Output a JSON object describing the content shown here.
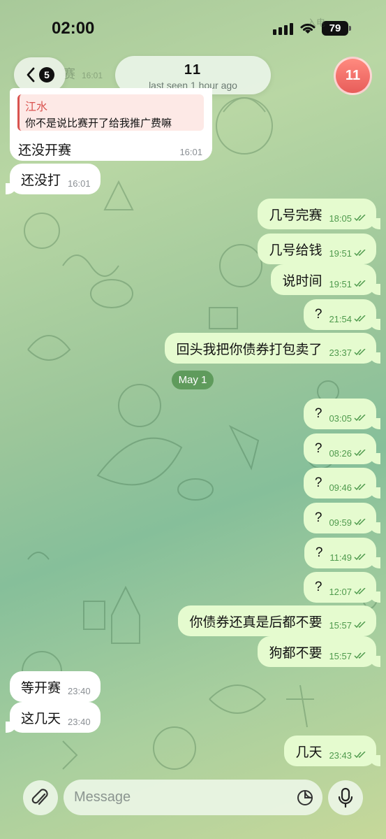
{
  "status": {
    "time": "02:00",
    "battery": "79"
  },
  "header": {
    "back_badge": "5",
    "chat_name": "11",
    "last_seen": "last seen 1 hour ago",
    "avatar_text": "11"
  },
  "ghost": {
    "behind_back": "赛",
    "behind_back_time": "16:01",
    "top_right": "入电"
  },
  "reply_message": {
    "quote_name": "江水",
    "quote_text": "你不是说比赛开了给我推广费嘛",
    "text": "还没开赛",
    "time": "16:01"
  },
  "messages": [
    {
      "text": "还没打",
      "time": "16:01"
    },
    {
      "text": "几号完赛",
      "time": "18:05"
    },
    {
      "text": "几号给钱",
      "time": "19:51"
    },
    {
      "text": "说时间",
      "time": "19:51"
    },
    {
      "text": "?",
      "time": "21:54"
    },
    {
      "text": "回头我把你债券打包卖了",
      "time": "23:37"
    },
    {
      "text": "?",
      "time": "03:05"
    },
    {
      "text": "?",
      "time": "08:26"
    },
    {
      "text": "?",
      "time": "09:46"
    },
    {
      "text": "?",
      "time": "09:59"
    },
    {
      "text": "?",
      "time": "11:49"
    },
    {
      "text": "?",
      "time": "12:07"
    },
    {
      "text": "你债券还真是后都不要",
      "time": "15:57"
    },
    {
      "text": "狗都不要",
      "time": "15:57"
    },
    {
      "text": "等开赛",
      "time": "23:40"
    },
    {
      "text": "这几天",
      "time": "23:40"
    },
    {
      "text": "几天",
      "time": "23:43"
    }
  ],
  "date_separator": "May 1",
  "composer": {
    "placeholder": "Message"
  },
  "colors": {
    "outgoing": "#e5fbcf",
    "incoming": "#ffffff",
    "accent": "#4f9a4d",
    "avatar": "#e85d5a"
  }
}
